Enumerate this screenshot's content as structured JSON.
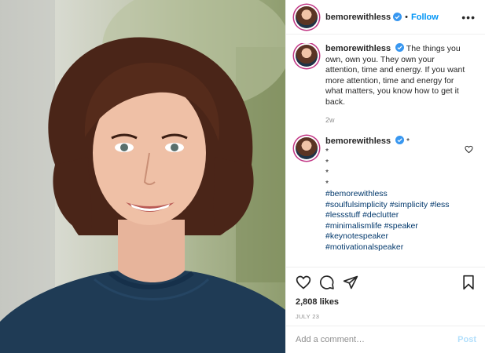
{
  "header": {
    "username": "bemorewithless",
    "dot": "•",
    "follow_label": "Follow",
    "more_label": "•••"
  },
  "caption": {
    "username": "bemorewithless",
    "text": "The things you own, own you. They own your attention, time and energy. If you want more attention, time and energy for what matters, you know how to get it back.",
    "age": "2w"
  },
  "comment": {
    "username": "bemorewithless",
    "lines": [
      "*",
      "*",
      "*",
      "*",
      "*"
    ],
    "hashtags": [
      "#bemorewithless",
      "#soulfulsimplicity #simplicity #less",
      "#lessstuff #declutter",
      "#minimalismlife #speaker",
      "#keynotespeaker",
      "#motivationalspeaker"
    ]
  },
  "actions": {
    "likes": "2,808 likes",
    "date": "JULY 23"
  },
  "add_comment": {
    "placeholder": "Add a comment…",
    "post_label": "Post"
  },
  "icons": {
    "like": "heart-icon",
    "comment": "comment-icon",
    "share": "share-icon",
    "save": "bookmark-icon",
    "verified": "verified-badge-icon",
    "comment_like": "heart-icon"
  },
  "colors": {
    "accent": "#0095f6",
    "hashtag": "#00376b",
    "muted": "#8e8e8e",
    "post_disabled": "#b2dffc"
  }
}
